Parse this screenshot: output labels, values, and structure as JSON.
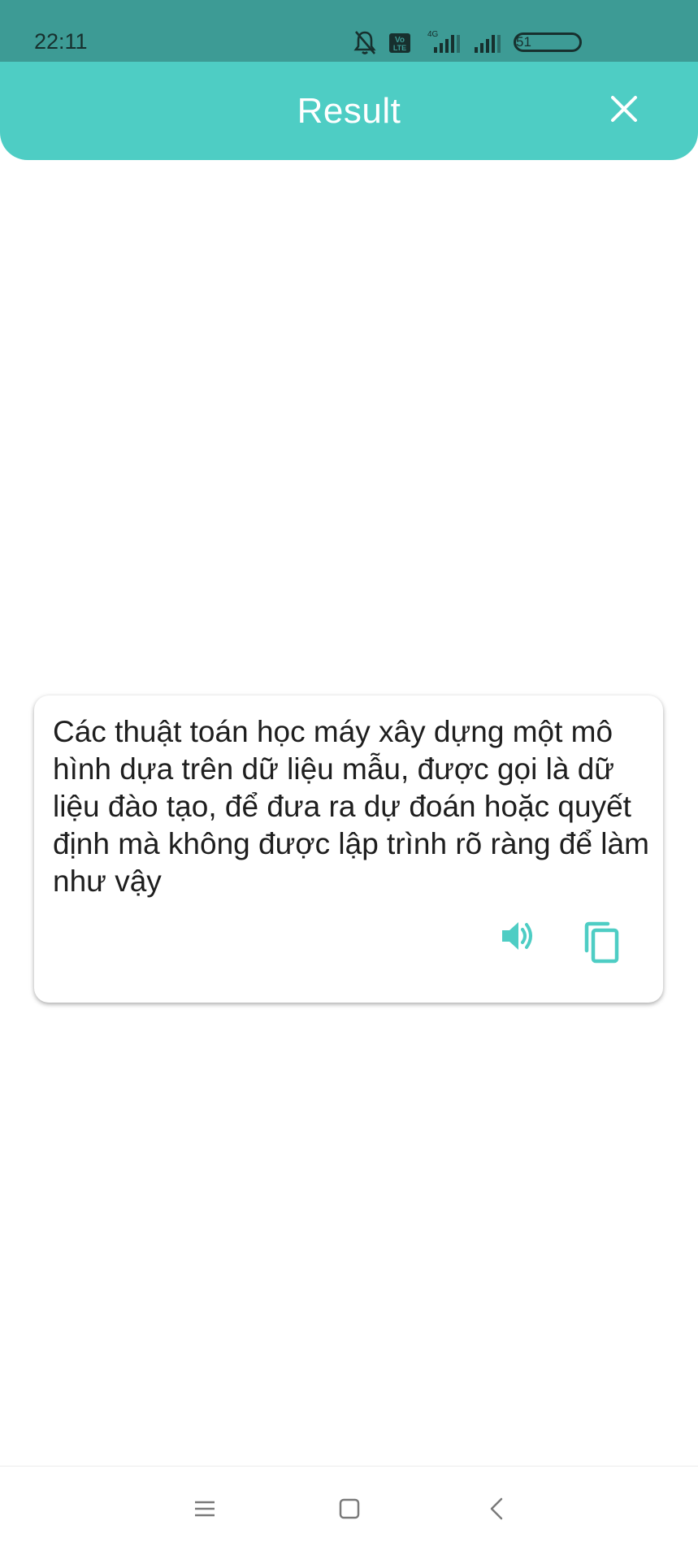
{
  "status_bar": {
    "time": "22:11",
    "network_label": "4G",
    "volte_label": "Vo LTE",
    "battery": "51",
    "icons": [
      "mute-bell-icon",
      "volte-icon",
      "signal-icon",
      "signal-icon",
      "battery-icon"
    ]
  },
  "header": {
    "title": "Result",
    "close_icon": "close-icon"
  },
  "result": {
    "text": "Các thuật toán học máy xây dựng một mô hình dựa trên dữ liệu mẫu, được gọi là dữ liệu đào tạo, để đưa ra dự đoán hoặc quyết định mà không được lập trình rõ ràng để làm như vậy",
    "actions": [
      "speaker-icon",
      "copy-icon"
    ]
  },
  "nav_bar": {
    "buttons": [
      "menu-icon",
      "home-icon",
      "back-icon"
    ]
  },
  "colors": {
    "status_bar": "#3d9b95",
    "header": "#4ecdc4",
    "accent_icon": "#4ecdc4",
    "text": "#1e1e1e"
  }
}
